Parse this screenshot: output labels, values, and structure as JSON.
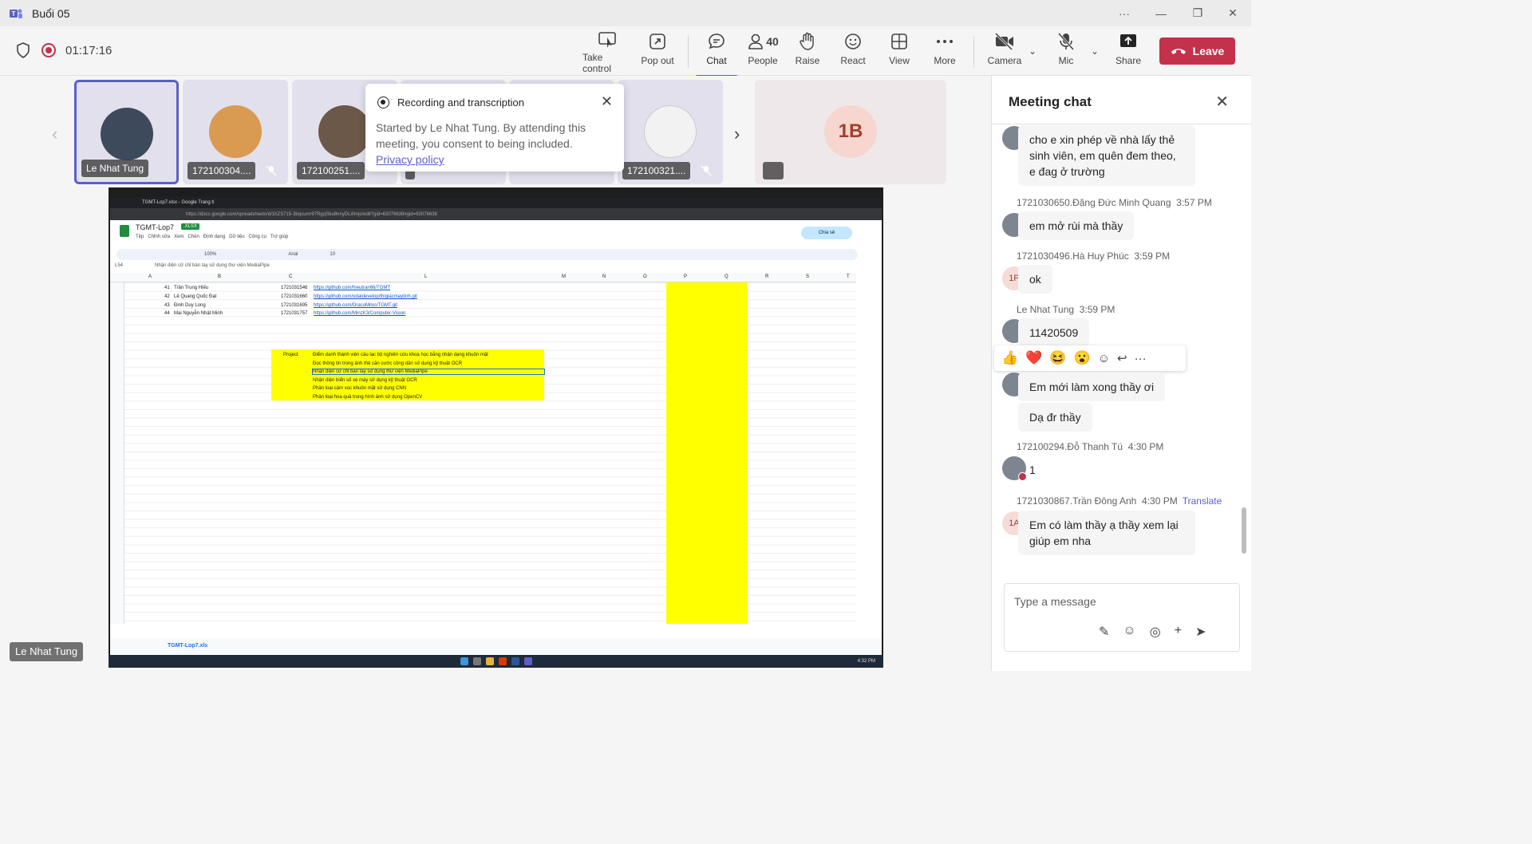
{
  "window": {
    "title": "Buổi 05",
    "more_label": "···",
    "minimize": "—",
    "restore": "❐",
    "close": "✕"
  },
  "meeting": {
    "timer": "01:17:16",
    "buttons": {
      "take_control": "Take control",
      "pop_out": "Pop out",
      "chat": "Chat",
      "people": "People",
      "people_count": "40",
      "raise": "Raise",
      "react": "React",
      "view": "View",
      "more": "More",
      "camera": "Camera",
      "mic": "Mic",
      "share": "Share",
      "leave": "Leave"
    }
  },
  "participants": [
    {
      "name": "Le Nhat Tung"
    },
    {
      "name": "172100304...."
    },
    {
      "name": "172100251...."
    },
    {
      "name": ""
    },
    {
      "name": "172100321...."
    },
    {
      "name": "",
      "initials": "1B"
    }
  ],
  "recording_popup": {
    "title": "Recording and transcription",
    "body": "Started by Le Nhat Tung. By attending this meeting, you consent to being included.",
    "link": "Privacy policy"
  },
  "shared_screen": {
    "browser_tab": "TGMT-Lop7.xlsx - Google Trang tí",
    "url": "https://docs.google.com/spreadsheets/d/1hZS715-3bqcumr97RgqSbu8nnyDLi0mjc/edit?gid=63076638#gid=63076638",
    "doc_title": "TGMT-Lop7",
    "doc_ext": ".XLSX",
    "menu": [
      "Tệp",
      "Chỉnh sửa",
      "Xem",
      "Chèn",
      "Định dạng",
      "Dữ liệu",
      "Công cụ",
      "Trợ giúp"
    ],
    "share_label": "Chia sẻ",
    "cell_ref": "L54",
    "formula": "Nhận diện cử chỉ bàn tay sử dụng thư viện MediaPipe",
    "font": "Arial",
    "zoom": "100%",
    "font_size": "10",
    "columns": [
      "A",
      "B",
      "C",
      "L",
      "M",
      "N",
      "O",
      "P",
      "Q",
      "R",
      "S",
      "T"
    ],
    "students": [
      {
        "no": "41",
        "name": "Trần Trung Hiếu",
        "id": "1721031546",
        "link": "https://github.com/hieutran66/TGMT"
      },
      {
        "no": "42",
        "name": "Lê Quang Quốc Đạt",
        "id": "1721031660",
        "link": "https://github.com/odatdevelop/thigiacmaytinh.git"
      },
      {
        "no": "43",
        "name": "Đinh Duy Long",
        "id": "1721031695",
        "link": "https://github.com/DracoMilos/TGMT.git"
      },
      {
        "no": "44",
        "name": "Mai Nguyễn Nhật Minh",
        "id": "1721031757",
        "link": "https://github.com/MinzK3/Computer-Vision"
      }
    ],
    "project_label": "Project",
    "projects": [
      "Điểm danh thành viên câu lạc bộ nghiên cứu khoa học bằng nhận dạng khuôn mặt",
      "Đọc thông tin trong ảnh thẻ căn cước công dân sử dụng kỹ thuật OCR",
      "Nhận diện cử chỉ bàn tay sử dụng thư viện MediaPipe",
      "Nhận diện biển số xe máy sử dụng kỹ thuật OCR",
      "Phân loại cảm xúc khuôn mặt sử dụng CNN",
      "Phân loại hoa quả trong hình ảnh sử dụng OpenCV"
    ],
    "sheet_tab": "TGMT-Lop7.xls",
    "clock": "4:32 PM",
    "presenter": "Le Nhat Tung"
  },
  "chat": {
    "title": "Meeting chat",
    "messages": [
      {
        "author": "",
        "time": "",
        "text": "cho e xin phép về nhà lấy thẻ sinh viên, em quên đem theo, e đag ở trường"
      },
      {
        "author": "1721030650.Đặng Đức Minh Quang",
        "time": "3:57 PM",
        "text": "em mở rùi mà thầy"
      },
      {
        "author": "1721030496.Hà Huy Phúc",
        "time": "3:59 PM",
        "text": "ok",
        "initials": "1P"
      },
      {
        "author": "Le Nhat Tung",
        "time": "3:59 PM",
        "text": "11420509"
      },
      {
        "author": "",
        "time": "",
        "text": "Em mới làm xong thầy ơi"
      },
      {
        "author": "",
        "time": "",
        "text": "Dạ đr thầy"
      },
      {
        "author": "172100294.Đỗ Thanh Tú",
        "time": "4:30 PM",
        "text": "1"
      },
      {
        "author": "1721030867.Trần Đông Anh",
        "time": "4:30 PM",
        "text": "Em có làm thầy ạ thầy xem lại giúp em nha",
        "initials": "1A",
        "translate": "Translate"
      }
    ],
    "reactions": [
      "👍",
      "❤️",
      "😆",
      "😮"
    ],
    "compose_placeholder": "Type a message"
  },
  "colors": {
    "accent": "#5b5fc7",
    "leave": "#c4314b",
    "highlight": "#ffff00"
  }
}
